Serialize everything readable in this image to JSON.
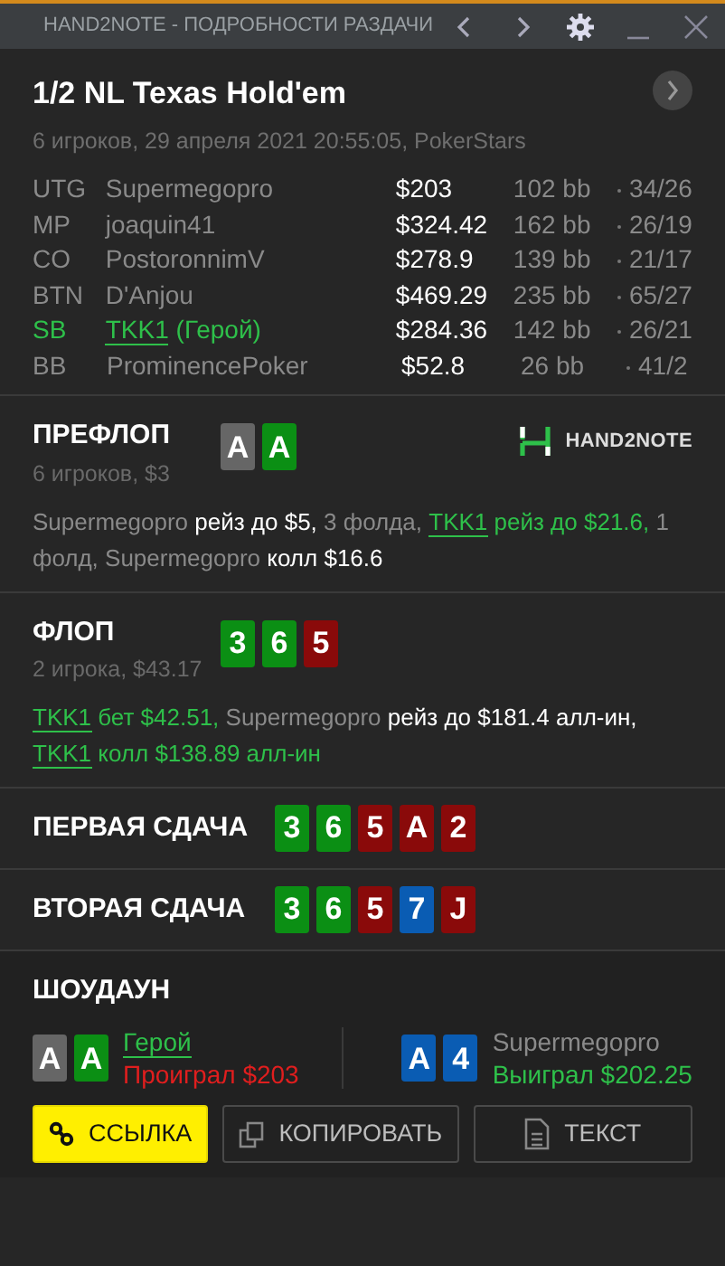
{
  "window": {
    "title": "HAND2NOTE - ПОДРОБНОСТИ РАЗДАЧИ"
  },
  "header": {
    "title": "1/2 NL Texas Hold'em",
    "subtitle": "6 игроков, 29 апреля 2021 20:55:05, PokerStars"
  },
  "players": [
    {
      "position": "UTG",
      "name": "Supermegopro",
      "stack": "$203",
      "bb": "102 bb",
      "stats": "34/26",
      "hero": false
    },
    {
      "position": "MP",
      "name": "joaquin41",
      "stack": "$324.42",
      "bb": "162 bb",
      "stats": "26/19",
      "hero": false
    },
    {
      "position": "CO",
      "name": "PostoronnimV",
      "stack": "$278.9",
      "bb": "139 bb",
      "stats": "21/17",
      "hero": false
    },
    {
      "position": "BTN",
      "name": "D'Anjou",
      "stack": "$469.29",
      "bb": "235 bb",
      "stats": "65/27",
      "hero": false
    },
    {
      "position": "SB",
      "name": "TKK1",
      "hero_tag": "(Герой)",
      "stack": "$284.36",
      "bb": "142 bb",
      "stats": "26/21",
      "hero": true
    },
    {
      "position": "BB",
      "name": "ProminencePoker",
      "stack": "$52.8",
      "bb": "26 bb",
      "stats": "41/2",
      "hero": false
    }
  ],
  "streets": [
    {
      "kind": "detailed",
      "title": "ПРЕФЛОП",
      "subtitle": "6 игроков, $3",
      "logo": "HAND2NOTE",
      "cards": [
        {
          "rank": "A",
          "color": "#666666"
        },
        {
          "rank": "A",
          "color": "#0b8f14"
        }
      ],
      "actions": [
        {
          "kind": "player",
          "text": "Supermegopro "
        },
        {
          "kind": "action",
          "text": "рейз до $5,"
        },
        {
          "kind": "player",
          "text": " 3 фолда, "
        },
        {
          "kind": "hero",
          "text": "TKK1"
        },
        {
          "kind": "hero_action",
          "text": " рейз до $21.6,"
        },
        {
          "kind": "player",
          "text": " 1 фолд, Supermegopro "
        },
        {
          "kind": "action",
          "text": "колл $16.6"
        }
      ]
    },
    {
      "kind": "detailed",
      "title": "ФЛОП",
      "subtitle": "2 игрока, $43.17",
      "cards": [
        {
          "rank": "3",
          "color": "#0b8f14"
        },
        {
          "rank": "6",
          "color": "#0b8f14"
        },
        {
          "rank": "5",
          "color": "#8a0a0a"
        }
      ],
      "actions": [
        {
          "kind": "hero",
          "text": "TKK1"
        },
        {
          "kind": "hero_action",
          "text": " бет $42.51,"
        },
        {
          "kind": "player",
          "text": " Supermegopro "
        },
        {
          "kind": "action",
          "text": "рейз до $181.4 алл-ин, "
        },
        {
          "kind": "hero",
          "text": "TKK1"
        },
        {
          "kind": "hero_action",
          "text": " колл $138.89 алл-ин"
        }
      ]
    },
    {
      "kind": "run",
      "title": "ПЕРВАЯ СДАЧА",
      "cards": [
        {
          "rank": "3",
          "color": "#0b8f14"
        },
        {
          "rank": "6",
          "color": "#0b8f14"
        },
        {
          "rank": "5",
          "color": "#8a0a0a"
        },
        {
          "rank": "A",
          "color": "#8a0a0a"
        },
        {
          "rank": "2",
          "color": "#8a0a0a"
        }
      ]
    },
    {
      "kind": "run",
      "title": "ВТОРАЯ СДАЧА",
      "cards": [
        {
          "rank": "3",
          "color": "#0b8f14"
        },
        {
          "rank": "6",
          "color": "#0b8f14"
        },
        {
          "rank": "5",
          "color": "#8a0a0a"
        },
        {
          "rank": "7",
          "color": "#0a5cb3"
        },
        {
          "rank": "J",
          "color": "#8a0a0a"
        }
      ]
    }
  ],
  "showdown": {
    "title": "ШОУДАУН",
    "hands": [
      {
        "name": "Герой",
        "hero": true,
        "result": "Проиграл $203",
        "won": false,
        "cards": [
          {
            "rank": "A",
            "color": "#666666"
          },
          {
            "rank": "A",
            "color": "#0b8f14"
          }
        ]
      },
      {
        "name": "Supermegopro",
        "hero": false,
        "result": "Выиграл $202.25",
        "won": true,
        "cards": [
          {
            "rank": "A",
            "color": "#0a5cb3"
          },
          {
            "rank": "4",
            "color": "#0a5cb3"
          }
        ]
      }
    ]
  },
  "buttons": [
    {
      "label": "ССЫЛКА",
      "kind": "link"
    },
    {
      "label": "КОПИРОВАТЬ",
      "kind": "copy"
    },
    {
      "label": "ТЕКСТ",
      "kind": "text"
    }
  ]
}
